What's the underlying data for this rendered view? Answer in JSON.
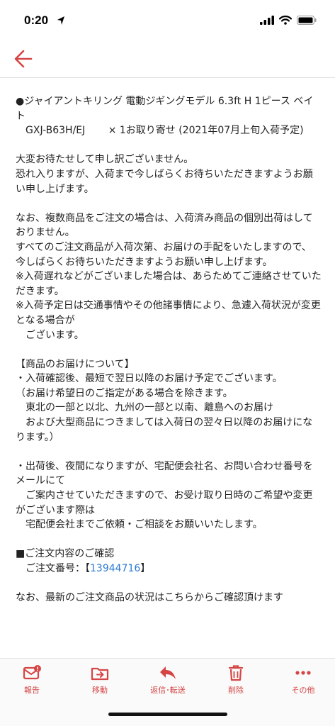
{
  "status": {
    "time": "0:20"
  },
  "colors": {
    "accent": "#d64545",
    "link": "#2a7ad6"
  },
  "email": {
    "paragraphs": [
      "●ジャイアントキリング 電動ジギングモデル 6.3ft H 1ピース ベイト\n　GXJ-B63H/EJ　　 × 1お取り寄せ (2021年07月上旬入荷予定)",
      "大変お待たせして申し訳ございません。\n恐れ入りますが、入荷まで今しばらくお待ちいただきますようお願い申し上げます。",
      "なお、複数商品をご注文の場合は、入荷済み商品の個別出荷はしておりません。\nすべてのご注文商品が入荷次第、お届けの手配をいたしますので、\n今しばらくお待ちいただきますようお願い申し上げます。\n※入荷遅れなどがございました場合は、あらためてご連絡させていただきます。\n※入荷予定日は交通事情やその他諸事情により、急遽入荷状況が変更となる場合が\n　ございます。",
      "【商品のお届けについて】\n・入荷確認後、最短で翌日以降のお届け予定でございます。\n（お届け希望日のご指定がある場合を除きます。\n　東北の一部と以北、九州の一部と以南、離島へのお届け\n　および大型商品につきましては入荷日の翌々日以降のお届けになります。）",
      "・出荷後、夜間になりますが、宅配便会社名、お問い合わせ番号をメールにて\n　ご案内させていただきますので、お受け取り日時のご希望や変更がございます際は\n　宅配便会社までご依頼・ご相談をお願いいたします。"
    ],
    "order_heading": "■ご注文内容のご確認",
    "order_label": "　ご注文番号：【",
    "order_number": "13944716",
    "order_suffix": "】",
    "cutoff_line": "なお、最新のご注文商品の状況はこちらからご確認頂けます"
  },
  "toolbar": {
    "items": [
      {
        "label": "報告",
        "icon": "report-icon"
      },
      {
        "label": "移動",
        "icon": "move-icon"
      },
      {
        "label": "返信･転送",
        "icon": "reply-icon"
      },
      {
        "label": "削除",
        "icon": "trash-icon"
      },
      {
        "label": "その他",
        "icon": "more-icon"
      }
    ]
  }
}
